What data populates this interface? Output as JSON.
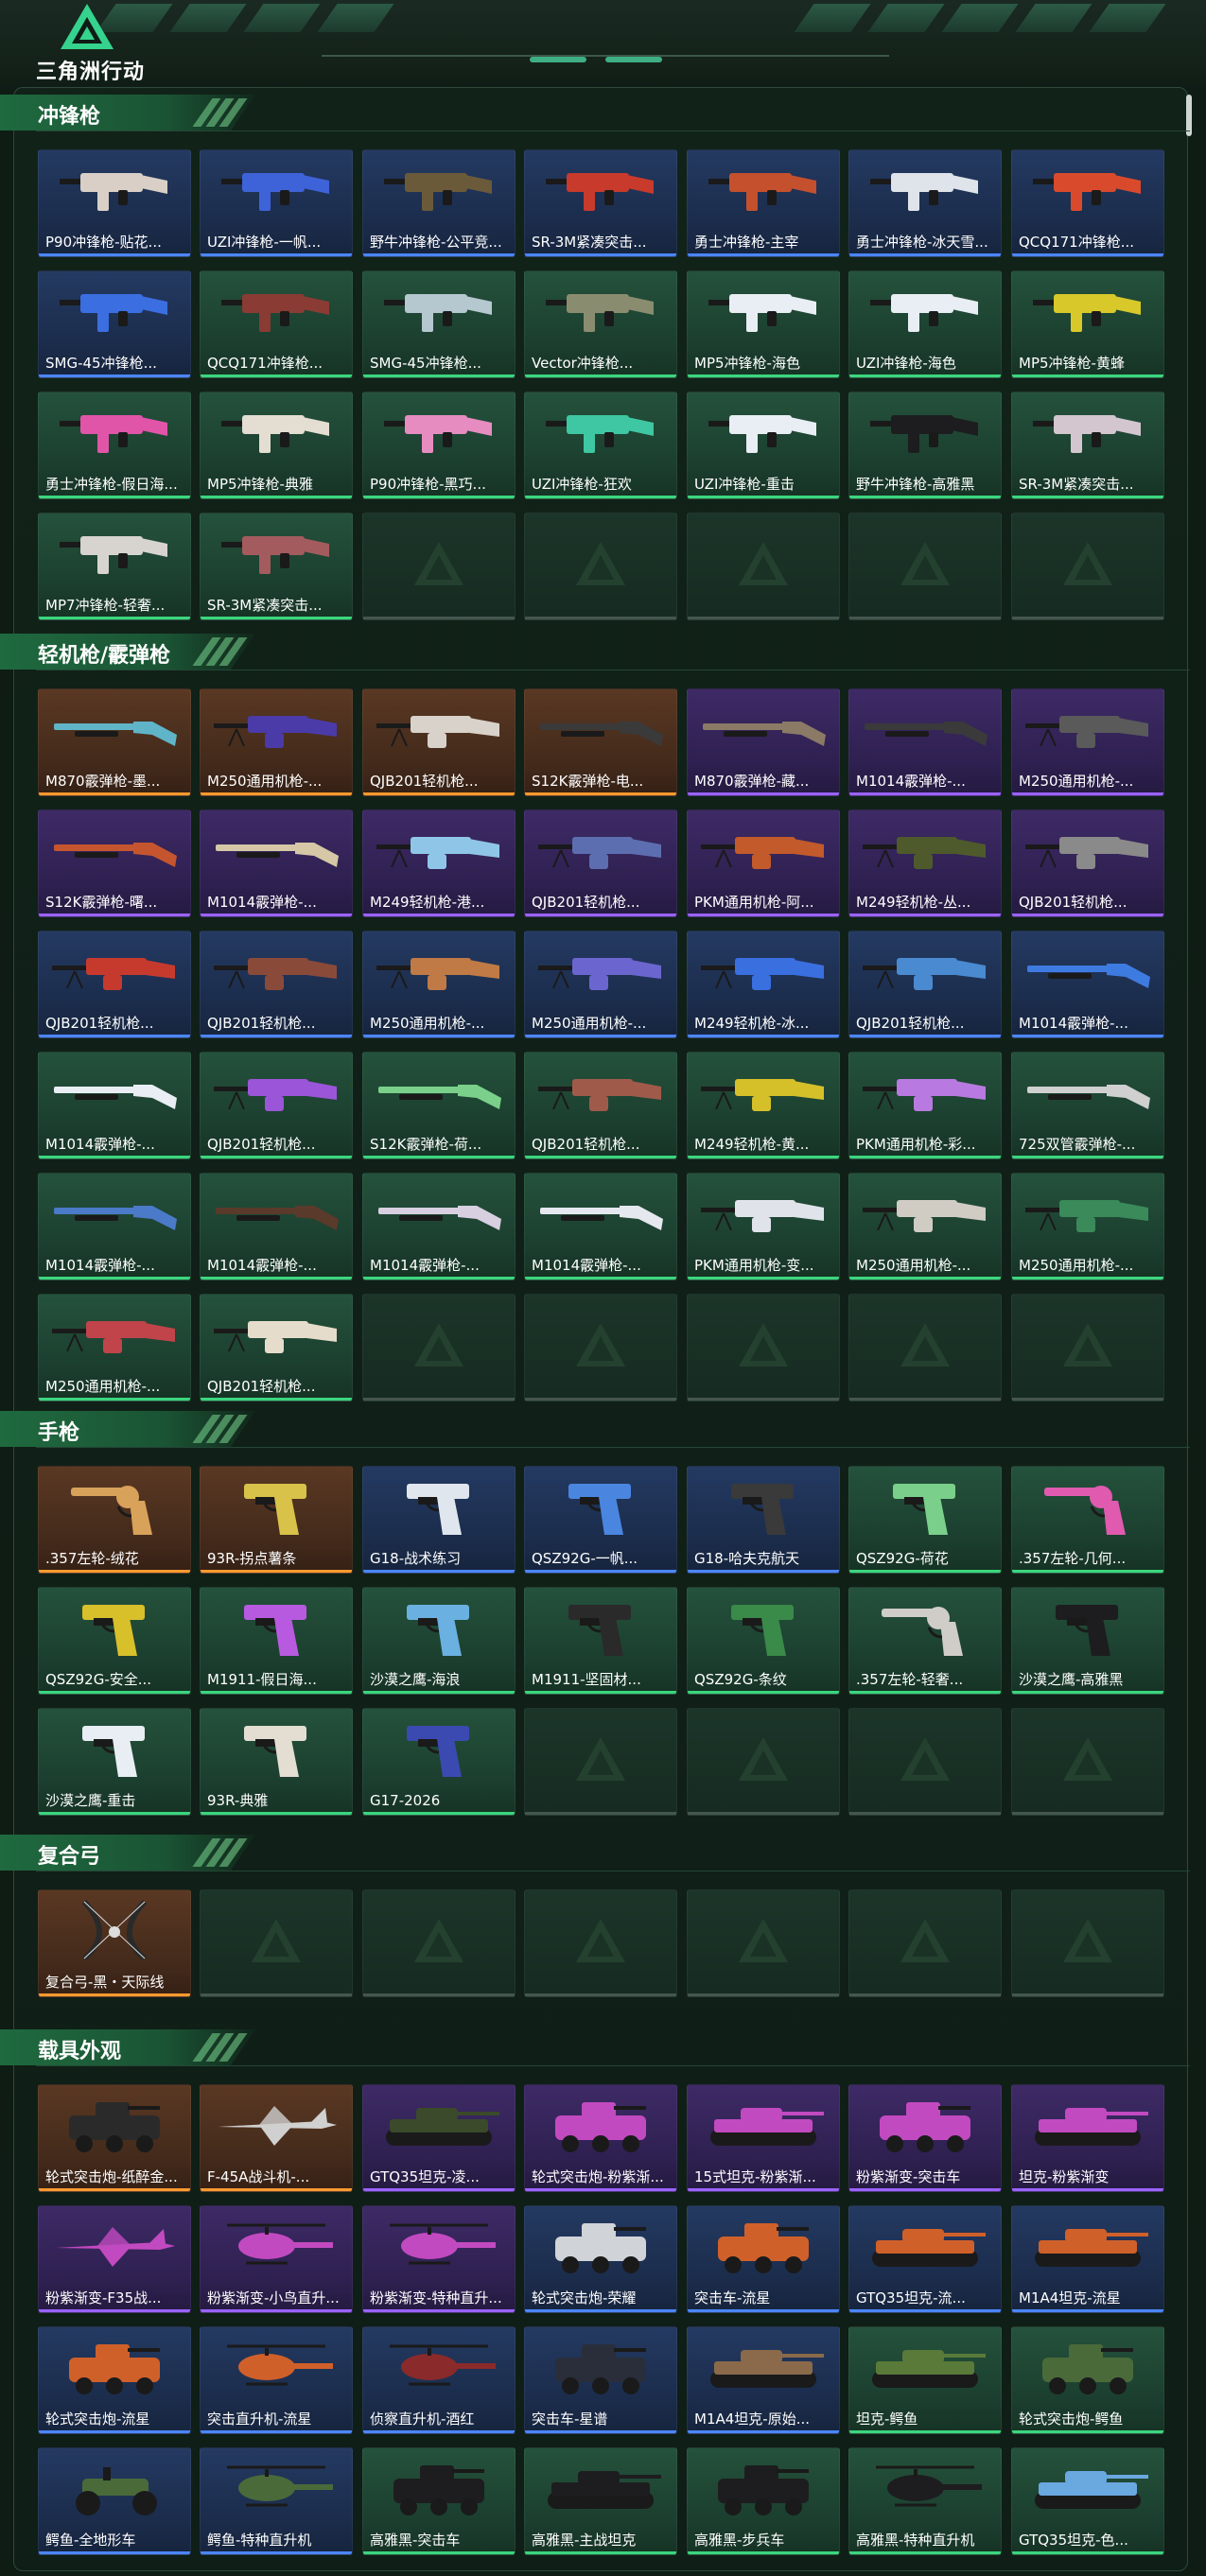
{
  "header": {
    "logo_text": "三角洲行动"
  },
  "colors": {
    "blue_rarity": "#4b86ff",
    "green_rarity": "#3bd67e",
    "purple_rarity": "#9a63ff",
    "gold_rarity": "#ff9a2e"
  },
  "sections": [
    {
      "title": "冲锋枪",
      "slots": 28,
      "items": [
        {
          "name": "P90冲锋枪-贴花...",
          "rarity": "blue",
          "kind": "smg",
          "tint": "#d9cfc6"
        },
        {
          "name": "UZI冲锋枪-一帆...",
          "rarity": "blue",
          "kind": "smg",
          "tint": "#3e63d8"
        },
        {
          "name": "野牛冲锋枪-公平竞...",
          "rarity": "blue",
          "kind": "smg",
          "tint": "#6b5a3a"
        },
        {
          "name": "SR-3M紧凑突击...",
          "rarity": "blue",
          "kind": "smg",
          "tint": "#c83a2c"
        },
        {
          "name": "勇士冲锋枪-主宰",
          "rarity": "blue",
          "kind": "smg",
          "tint": "#c4502e"
        },
        {
          "name": "勇士冲锋枪-冰天雪...",
          "rarity": "blue",
          "kind": "smg",
          "tint": "#dfe3ea"
        },
        {
          "name": "QCQ171冲锋枪...",
          "rarity": "blue",
          "kind": "smg",
          "tint": "#d94a2c"
        },
        {
          "name": "SMG-45冲锋枪...",
          "rarity": "blue",
          "kind": "smg",
          "tint": "#3b6ee0"
        },
        {
          "name": "QCQ171冲锋枪...",
          "rarity": "green",
          "kind": "smg",
          "tint": "#8a3b34"
        },
        {
          "name": "SMG-45冲锋枪...",
          "rarity": "green",
          "kind": "smg",
          "tint": "#b5c7cf"
        },
        {
          "name": "Vector冲锋枪...",
          "rarity": "green",
          "kind": "smg",
          "tint": "#8a8c70"
        },
        {
          "name": "MP5冲锋枪-海色",
          "rarity": "green",
          "kind": "smg",
          "tint": "#e8eef4"
        },
        {
          "name": "UZI冲锋枪-海色",
          "rarity": "green",
          "kind": "smg",
          "tint": "#e8eef4"
        },
        {
          "name": "MP5冲锋枪-黄蜂",
          "rarity": "green",
          "kind": "smg",
          "tint": "#d8c82a"
        },
        {
          "name": "勇士冲锋枪-假日海...",
          "rarity": "green",
          "kind": "smg",
          "tint": "#e055a8"
        },
        {
          "name": "MP5冲锋枪-典雅",
          "rarity": "green",
          "kind": "smg",
          "tint": "#e4ddd2"
        },
        {
          "name": "P90冲锋枪-黑巧...",
          "rarity": "green",
          "kind": "smg",
          "tint": "#e68cc0"
        },
        {
          "name": "UZI冲锋枪-狂欢",
          "rarity": "green",
          "kind": "smg",
          "tint": "#3ec7a2"
        },
        {
          "name": "UZI冲锋枪-重击",
          "rarity": "green",
          "kind": "smg",
          "tint": "#e8eef4"
        },
        {
          "name": "野牛冲锋枪-高雅黑",
          "rarity": "green",
          "kind": "smg",
          "tint": "#1d1d1f"
        },
        {
          "name": "SR-3M紧凑突击...",
          "rarity": "green",
          "kind": "smg",
          "tint": "#d3c6cf"
        },
        {
          "name": "MP7冲锋枪-轻奢...",
          "rarity": "green",
          "kind": "smg",
          "tint": "#d7d4cf"
        },
        {
          "name": "SR-3M紧凑突击...",
          "rarity": "green",
          "kind": "smg",
          "tint": "#a35b5e"
        }
      ]
    },
    {
      "title": "轻机枪/霰弹枪",
      "slots": 42,
      "items": [
        {
          "name": "M870霰弹枪-墨...",
          "rarity": "gold",
          "kind": "shotgun",
          "tint": "#5fb4c8"
        },
        {
          "name": "M250通用机枪-...",
          "rarity": "gold",
          "kind": "lmg",
          "tint": "#4b3ba8"
        },
        {
          "name": "QJB201轻机枪...",
          "rarity": "gold",
          "kind": "lmg",
          "tint": "#d8d2ca"
        },
        {
          "name": "S12K霰弹枪-电...",
          "rarity": "gold",
          "kind": "shotgun",
          "tint": "#3a3a3a"
        },
        {
          "name": "M870霰弹枪-藏...",
          "rarity": "purple",
          "kind": "shotgun",
          "tint": "#8a7a66"
        },
        {
          "name": "M1014霰弹枪-...",
          "rarity": "purple",
          "kind": "shotgun",
          "tint": "#3a3a3a"
        },
        {
          "name": "M250通用机枪-...",
          "rarity": "purple",
          "kind": "lmg",
          "tint": "#5a5a5a"
        },
        {
          "name": "S12K霰弹枪-曙...",
          "rarity": "purple",
          "kind": "shotgun",
          "tint": "#c4552f"
        },
        {
          "name": "M1014霰弹枪-...",
          "rarity": "purple",
          "kind": "shotgun",
          "tint": "#d6c7a6"
        },
        {
          "name": "M249轻机枪-港...",
          "rarity": "purple",
          "kind": "lmg",
          "tint": "#8fc6e8"
        },
        {
          "name": "QJB201轻机枪...",
          "rarity": "purple",
          "kind": "lmg",
          "tint": "#5c6eb0"
        },
        {
          "name": "PKM通用机枪-阿...",
          "rarity": "purple",
          "kind": "lmg",
          "tint": "#c25a2c"
        },
        {
          "name": "M249轻机枪-丛...",
          "rarity": "purple",
          "kind": "lmg",
          "tint": "#4e5a2c"
        },
        {
          "name": "QJB201轻机枪...",
          "rarity": "purple",
          "kind": "lmg",
          "tint": "#8a8a8a"
        },
        {
          "name": "QJB201轻机枪...",
          "rarity": "blue",
          "kind": "lmg",
          "tint": "#c63a2e"
        },
        {
          "name": "QJB201轻机枪...",
          "rarity": "blue",
          "kind": "lmg",
          "tint": "#8a4a3a"
        },
        {
          "name": "M250通用机枪-...",
          "rarity": "blue",
          "kind": "lmg",
          "tint": "#c07a45"
        },
        {
          "name": "M250通用机枪-...",
          "rarity": "blue",
          "kind": "lmg",
          "tint": "#6b66cf"
        },
        {
          "name": "M249轻机枪-冰...",
          "rarity": "blue",
          "kind": "lmg",
          "tint": "#3a6fe0"
        },
        {
          "name": "QJB201轻机枪...",
          "rarity": "blue",
          "kind": "lmg",
          "tint": "#4a8ad0"
        },
        {
          "name": "M1014霰弹枪-...",
          "rarity": "blue",
          "kind": "shotgun",
          "tint": "#3e7be0"
        },
        {
          "name": "M1014霰弹枪-...",
          "rarity": "green",
          "kind": "shotgun",
          "tint": "#e8eef4"
        },
        {
          "name": "QJB201轻机枪...",
          "rarity": "green",
          "kind": "lmg",
          "tint": "#9b55d8"
        },
        {
          "name": "S12K霰弹枪-荷...",
          "rarity": "green",
          "kind": "shotgun",
          "tint": "#7ad08a"
        },
        {
          "name": "QJB201轻机枪...",
          "rarity": "green",
          "kind": "lmg",
          "tint": "#a05a4a"
        },
        {
          "name": "M249轻机枪-黄...",
          "rarity": "green",
          "kind": "lmg",
          "tint": "#d6c02a"
        },
        {
          "name": "PKM通用机枪-彩...",
          "rarity": "green",
          "kind": "lmg",
          "tint": "#b87ae0"
        },
        {
          "name": "725双管霰弹枪-...",
          "rarity": "green",
          "kind": "shotgun",
          "tint": "#d0d0d0"
        },
        {
          "name": "M1014霰弹枪-...",
          "rarity": "green",
          "kind": "shotgun",
          "tint": "#4a7ac8"
        },
        {
          "name": "M1014霰弹枪-...",
          "rarity": "green",
          "kind": "shotgun",
          "tint": "#5a3a2a"
        },
        {
          "name": "M1014霰弹枪-...",
          "rarity": "green",
          "kind": "shotgun",
          "tint": "#d8d0e0"
        },
        {
          "name": "M1014霰弹枪-...",
          "rarity": "green",
          "kind": "shotgun",
          "tint": "#e6e8f0"
        },
        {
          "name": "PKM通用机枪-变...",
          "rarity": "green",
          "kind": "lmg",
          "tint": "#e0e4ea"
        },
        {
          "name": "M250通用机枪-...",
          "rarity": "green",
          "kind": "lmg",
          "tint": "#d0ccc4"
        },
        {
          "name": "M250通用机枪-...",
          "rarity": "green",
          "kind": "lmg",
          "tint": "#3a8a5a"
        },
        {
          "name": "M250通用机枪-...",
          "rarity": "green",
          "kind": "lmg",
          "tint": "#c0444a"
        },
        {
          "name": "QJB201轻机枪...",
          "rarity": "green",
          "kind": "lmg",
          "tint": "#e6dccb"
        }
      ]
    },
    {
      "title": "手枪",
      "slots": 21,
      "items": [
        {
          "name": ".357左轮-绒花",
          "rarity": "gold",
          "kind": "revolver",
          "tint": "#d8a25a"
        },
        {
          "name": "93R-拐点薯条",
          "rarity": "gold",
          "kind": "pistol",
          "tint": "#d8c24a"
        },
        {
          "name": "G18-战术练习",
          "rarity": "blue",
          "kind": "pistol",
          "tint": "#e0e6ee"
        },
        {
          "name": "QSZ92G-一帆...",
          "rarity": "blue",
          "kind": "pistol",
          "tint": "#4a86e0"
        },
        {
          "name": "G18-哈夫克航天",
          "rarity": "blue",
          "kind": "pistol",
          "tint": "#3a3a3a"
        },
        {
          "name": "QSZ92G-荷花",
          "rarity": "green",
          "kind": "pistol",
          "tint": "#7ad08a"
        },
        {
          "name": ".357左轮-几何...",
          "rarity": "green",
          "kind": "revolver",
          "tint": "#e05ab0"
        },
        {
          "name": "QSZ92G-安全...",
          "rarity": "green",
          "kind": "pistol",
          "tint": "#d8c02a"
        },
        {
          "name": "M1911-假日海...",
          "rarity": "green",
          "kind": "pistol",
          "tint": "#b85ae0"
        },
        {
          "name": "沙漠之鹰-海浪",
          "rarity": "green",
          "kind": "pistol",
          "tint": "#6ab0e0"
        },
        {
          "name": "M1911-坚固材...",
          "rarity": "green",
          "kind": "pistol",
          "tint": "#2a2a2a"
        },
        {
          "name": "QSZ92G-条纹",
          "rarity": "green",
          "kind": "pistol",
          "tint": "#3a8a4a"
        },
        {
          "name": ".357左轮-轻奢...",
          "rarity": "green",
          "kind": "revolver",
          "tint": "#d0ccc8"
        },
        {
          "name": "沙漠之鹰-高雅黑",
          "rarity": "green",
          "kind": "pistol",
          "tint": "#1d1d1f"
        },
        {
          "name": "沙漠之鹰-重击",
          "rarity": "green",
          "kind": "pistol",
          "tint": "#e8eef4"
        },
        {
          "name": "93R-典雅",
          "rarity": "green",
          "kind": "pistol",
          "tint": "#e4ddd2"
        },
        {
          "name": "G17-2026",
          "rarity": "green",
          "kind": "pistol",
          "tint": "#3a4ab0"
        }
      ]
    },
    {
      "title": "复合弓",
      "slots": 7,
      "items": [
        {
          "name": "复合弓-黑・天际线",
          "rarity": "gold",
          "kind": "bow",
          "tint": "#1a1a1a"
        }
      ]
    },
    {
      "title": "载具外观",
      "slots": 28,
      "items": [
        {
          "name": "轮式突击炮-纸醉金...",
          "rarity": "gold",
          "kind": "vehicle",
          "tint": "#2a2a2a"
        },
        {
          "name": "F-45A战斗机-...",
          "rarity": "gold",
          "kind": "jet",
          "tint": "#d0d0d0"
        },
        {
          "name": "GTQ35坦克-凌...",
          "rarity": "purple",
          "kind": "tank",
          "tint": "#3a4a2a"
        },
        {
          "name": "轮式突击炮-粉紫渐...",
          "rarity": "purple",
          "kind": "vehicle",
          "tint": "#c24ac0"
        },
        {
          "name": "15式坦克-粉紫渐...",
          "rarity": "purple",
          "kind": "tank",
          "tint": "#c24ac0"
        },
        {
          "name": "粉紫渐变-突击车",
          "rarity": "purple",
          "kind": "vehicle",
          "tint": "#c24ac0"
        },
        {
          "name": "坦克-粉紫渐变",
          "rarity": "purple",
          "kind": "tank",
          "tint": "#c24ac0"
        },
        {
          "name": "粉紫渐变-F35战...",
          "rarity": "purple",
          "kind": "jet",
          "tint": "#c24ac0"
        },
        {
          "name": "粉紫渐变-小鸟直升...",
          "rarity": "purple",
          "kind": "heli",
          "tint": "#c24ac0"
        },
        {
          "name": "粉紫渐变-特种直升...",
          "rarity": "purple",
          "kind": "heli",
          "tint": "#c24ac0"
        },
        {
          "name": "轮式突击炮-荣耀",
          "rarity": "blue",
          "kind": "vehicle",
          "tint": "#d0d4d8"
        },
        {
          "name": "突击车-流星",
          "rarity": "blue",
          "kind": "vehicle",
          "tint": "#d0602a"
        },
        {
          "name": "GTQ35坦克-流...",
          "rarity": "blue",
          "kind": "tank",
          "tint": "#d0602a"
        },
        {
          "name": "M1A4坦克-流星",
          "rarity": "blue",
          "kind": "tank",
          "tint": "#d0602a"
        },
        {
          "name": "轮式突击炮-流星",
          "rarity": "blue",
          "kind": "vehicle",
          "tint": "#d0602a"
        },
        {
          "name": "突击直升机-流星",
          "rarity": "blue",
          "kind": "heli",
          "tint": "#d0602a"
        },
        {
          "name": "侦察直升机-酒红",
          "rarity": "blue",
          "kind": "heli",
          "tint": "#8a2a2a"
        },
        {
          "name": "突击车-星谱",
          "rarity": "blue",
          "kind": "vehicle",
          "tint": "#2a2e3a"
        },
        {
          "name": "M1A4坦克-原始...",
          "rarity": "blue",
          "kind": "tank",
          "tint": "#8a6a4a"
        },
        {
          "name": "坦克-鳄鱼",
          "rarity": "green",
          "kind": "tank",
          "tint": "#5a7a3a"
        },
        {
          "name": "轮式突击炮-鳄鱼",
          "rarity": "green",
          "kind": "vehicle",
          "tint": "#4a6a3a"
        },
        {
          "name": "鳄鱼-全地形车",
          "rarity": "blue",
          "kind": "atv",
          "tint": "#4a6a3a"
        },
        {
          "name": "鳄鱼-特种直升机",
          "rarity": "blue",
          "kind": "heli",
          "tint": "#4a6a3a"
        },
        {
          "name": "高雅黑-突击车",
          "rarity": "green",
          "kind": "vehicle",
          "tint": "#1d1d1f"
        },
        {
          "name": "高雅黑-主战坦克",
          "rarity": "green",
          "kind": "tank",
          "tint": "#1d1d1f"
        },
        {
          "name": "高雅黑-步兵车",
          "rarity": "green",
          "kind": "vehicle",
          "tint": "#1d1d1f"
        },
        {
          "name": "高雅黑-特种直升机",
          "rarity": "green",
          "kind": "heli",
          "tint": "#1d1d1f"
        },
        {
          "name": "GTQ35坦克-色...",
          "rarity": "green",
          "kind": "tank",
          "tint": "#6aa8e0"
        }
      ]
    }
  ]
}
